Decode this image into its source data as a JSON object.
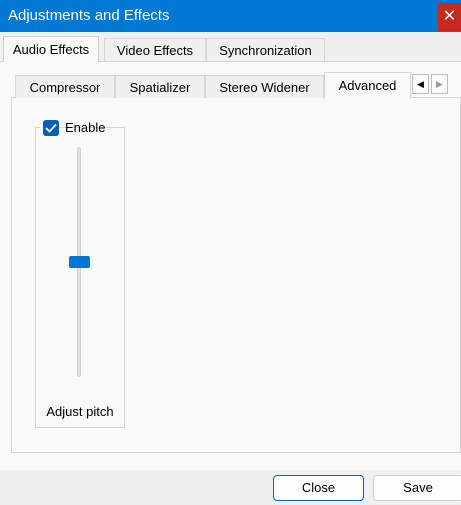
{
  "window": {
    "title": "Adjustments and Effects",
    "close_glyph": "✕"
  },
  "outer_tabs": [
    {
      "label": "Audio Effects",
      "active": true
    },
    {
      "label": "Video Effects",
      "active": false
    },
    {
      "label": "Synchronization",
      "active": false
    }
  ],
  "inner_tabs": [
    {
      "label": "Compressor",
      "active": false
    },
    {
      "label": "Spatializer",
      "active": false
    },
    {
      "label": "Stereo Widener",
      "active": false
    },
    {
      "label": "Advanced",
      "active": true
    }
  ],
  "tab_scroll": {
    "left_glyph": "◀",
    "right_glyph": "▶"
  },
  "advanced": {
    "enable_label": "Enable",
    "enable_checked": true,
    "pitch_slider": {
      "label": "Adjust pitch",
      "position_fraction": 0.5
    }
  },
  "buttons": {
    "close_label": "Close",
    "save_label": "Save"
  },
  "colors": {
    "accent": "#0078d4",
    "close_red": "#c42b1c"
  }
}
